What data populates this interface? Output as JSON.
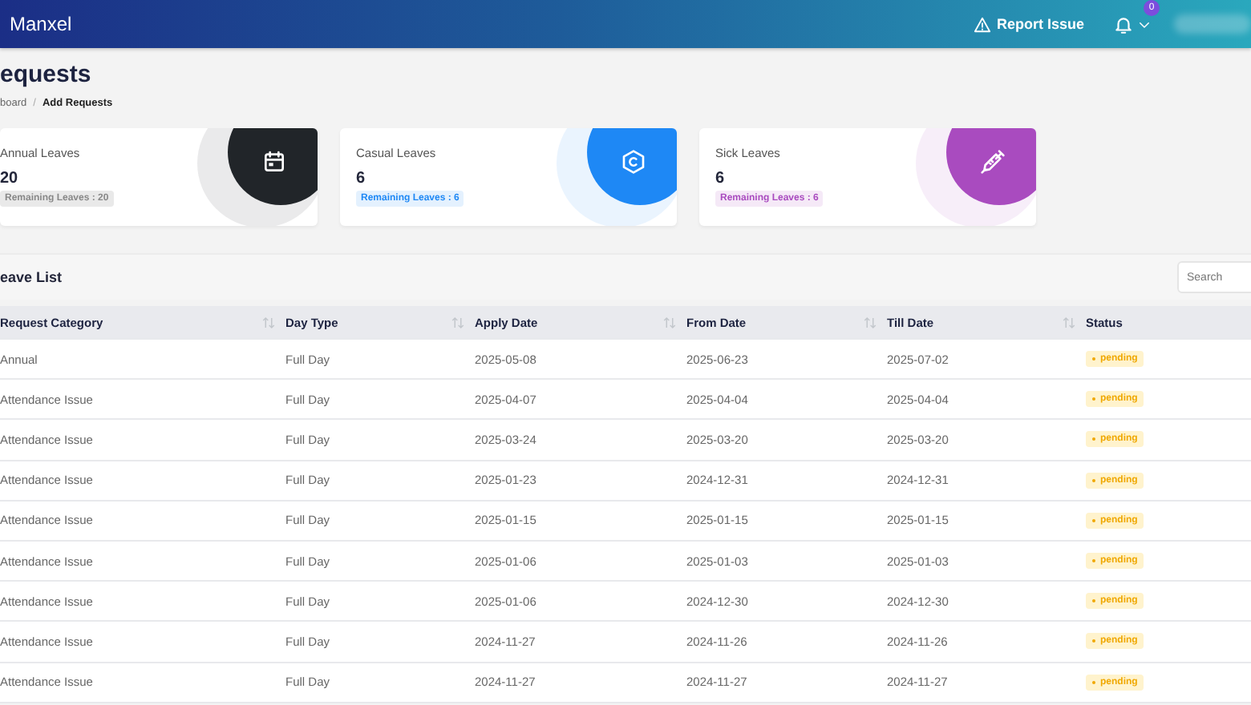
{
  "header": {
    "brand": "Manxel",
    "report_link": "Report Issue",
    "notification_count": "0"
  },
  "page": {
    "title": "equests",
    "breadcrumb": [
      "board",
      "Add Requests"
    ],
    "breadcrumb_separator": "/"
  },
  "cards": [
    {
      "label": "Annual Leaves",
      "value": "20",
      "remaining": "Remaining Leaves : 20",
      "color": "#212529"
    },
    {
      "label": "Casual Leaves",
      "value": "6",
      "remaining": "Remaining Leaves : 6",
      "color": "#1e88f5"
    },
    {
      "label": "Sick Leaves",
      "value": "6",
      "remaining": "Remaining Leaves : 6",
      "color": "#a94bbf"
    }
  ],
  "leave_list": {
    "title": "eave List",
    "search": {
      "placeholder": "Search"
    },
    "table": {
      "columns": [
        "Request Category",
        "Day Type",
        "Apply Date",
        "From Date",
        "Till Date",
        "Status"
      ],
      "rows": [
        [
          "Annual",
          "Full Day",
          "2025-05-08",
          "2025-06-23",
          "2025-07-02",
          "pending"
        ],
        [
          "Attendance Issue",
          "Full Day",
          "2025-04-07",
          "2025-04-04",
          "2025-04-04",
          "pending"
        ],
        [
          "Attendance Issue",
          "Full Day",
          "2025-03-24",
          "2025-03-20",
          "2025-03-20",
          "pending"
        ],
        [
          "Attendance Issue",
          "Full Day",
          "2025-01-23",
          "2024-12-31",
          "2024-12-31",
          "pending"
        ],
        [
          "Attendance Issue",
          "Full Day",
          "2025-01-15",
          "2025-01-15",
          "2025-01-15",
          "pending"
        ],
        [
          "Attendance Issue",
          "Full Day",
          "2025-01-06",
          "2025-01-03",
          "2025-01-03",
          "pending"
        ],
        [
          "Attendance Issue",
          "Full Day",
          "2025-01-06",
          "2024-12-30",
          "2024-12-30",
          "pending"
        ],
        [
          "Attendance Issue",
          "Full Day",
          "2024-11-27",
          "2024-11-26",
          "2024-11-26",
          "pending"
        ],
        [
          "Attendance Issue",
          "Full Day",
          "2024-11-27",
          "2024-11-27",
          "2024-11-27",
          "pending"
        ]
      ]
    }
  }
}
